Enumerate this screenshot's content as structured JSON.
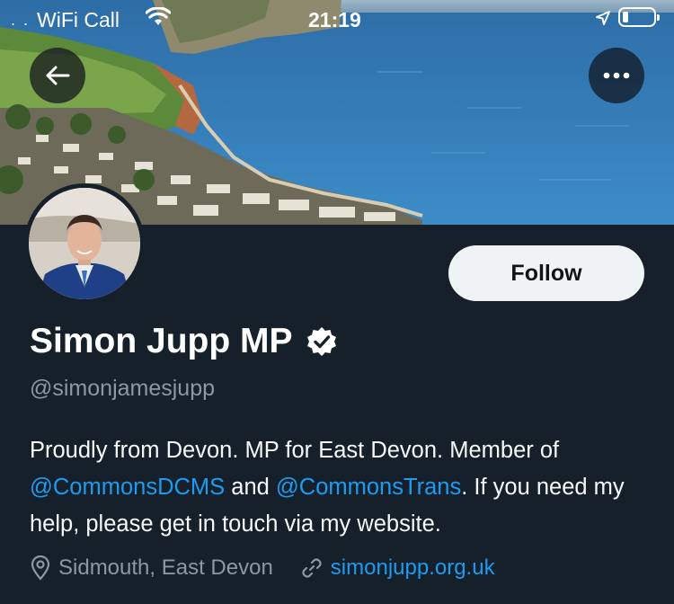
{
  "status_bar": {
    "carrier": "WiFi Call",
    "time": "21:19",
    "battery_level_percent": 20
  },
  "profile": {
    "name": "Simon Jupp MP",
    "handle": "@simonjamesjupp",
    "follow_label": "Follow",
    "bio": {
      "part1": "Proudly from Devon. MP for East Devon. Member of ",
      "mention1": "@CommonsDCMS",
      "part2": " and ",
      "mention2": "@CommonsTrans",
      "part3": ". If you need my help, please get in touch via my website."
    },
    "location": "Sidmouth, East Devon",
    "website": "simonjupp.org.uk"
  },
  "icons": {
    "back": "arrow-left-icon",
    "more": "more-horizontal-icon",
    "verified": "verified-badge-icon",
    "location": "map-pin-icon",
    "link": "link-icon",
    "wifi": "wifi-icon",
    "location_services": "location-arrow-icon",
    "battery": "battery-icon"
  },
  "colors": {
    "background": "#15202b",
    "accent": "#1d9bf0",
    "muted": "#8b98a5",
    "follow_button": "#eff3f4"
  }
}
